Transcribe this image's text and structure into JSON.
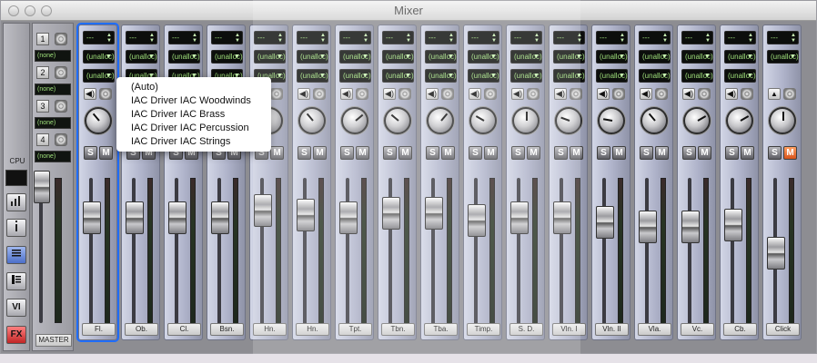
{
  "window": {
    "title": "Mixer"
  },
  "left_panel": {
    "cpu_label": "CPU",
    "buttons": [
      "",
      "",
      "",
      "",
      "VI",
      "FX"
    ]
  },
  "master": {
    "label": "MASTER",
    "rows": [
      {
        "num": "1",
        "route": "(none)"
      },
      {
        "num": "2",
        "route": "(none)"
      },
      {
        "num": "3",
        "route": "(none)"
      },
      {
        "num": "4",
        "route": "(none)"
      }
    ]
  },
  "strips": [
    {
      "name": "Fl.",
      "field1": "---",
      "field2": "(unalloc)",
      "field3": "(unalloc)",
      "solo": "S",
      "mute": "M",
      "fader_level": 0.8,
      "pan_deg": -40
    },
    {
      "name": "Ob.",
      "field1": "---",
      "field2": "(unalloc)",
      "field3": "(unalloc)",
      "solo": "S",
      "mute": "M",
      "fader_level": 0.8,
      "pan_deg": 0
    },
    {
      "name": "Cl.",
      "field1": "---",
      "field2": "(unalloc)",
      "field3": "(unalloc)",
      "solo": "S",
      "mute": "M",
      "fader_level": 0.8,
      "pan_deg": 0
    },
    {
      "name": "Bsn.",
      "field1": "---",
      "field2": "(unalloc)",
      "field3": "(unalloc)",
      "solo": "S",
      "mute": "M",
      "fader_level": 0.8,
      "pan_deg": 0
    },
    {
      "name": "Hn.",
      "field1": "---",
      "field2": "(unalloc)",
      "field3": "(unalloc)",
      "solo": "S",
      "mute": "M",
      "fader_level": 0.86,
      "pan_deg": 0
    },
    {
      "name": "Hn.",
      "field1": "---",
      "field2": "(unalloc)",
      "field3": "(unalloc)",
      "solo": "S",
      "mute": "M",
      "fader_level": 0.82,
      "pan_deg": -40
    },
    {
      "name": "Tpt.",
      "field1": "---",
      "field2": "(unalloc)",
      "field3": "(unalloc)",
      "solo": "S",
      "mute": "M",
      "fader_level": 0.8,
      "pan_deg": 50
    },
    {
      "name": "Tbn.",
      "field1": "---",
      "field2": "(unalloc)",
      "field3": "(unalloc)",
      "solo": "S",
      "mute": "M",
      "fader_level": 0.84,
      "pan_deg": -50
    },
    {
      "name": "Tba.",
      "field1": "---",
      "field2": "(unalloc)",
      "field3": "(unalloc)",
      "solo": "S",
      "mute": "M",
      "fader_level": 0.84,
      "pan_deg": 40
    },
    {
      "name": "Timp.",
      "field1": "---",
      "field2": "(unalloc)",
      "field3": "(unalloc)",
      "solo": "S",
      "mute": "M",
      "fader_level": 0.78,
      "pan_deg": -60
    },
    {
      "name": "S. D.",
      "field1": "---",
      "field2": "(unalloc)",
      "field3": "(unalloc)",
      "solo": "S",
      "mute": "M",
      "fader_level": 0.8,
      "pan_deg": 0
    },
    {
      "name": "Vln. I",
      "field1": "---",
      "field2": "(unalloc)",
      "field3": "(unalloc)",
      "solo": "S",
      "mute": "M",
      "fader_level": 0.8,
      "pan_deg": -70
    },
    {
      "name": "Vln. II",
      "field1": "---",
      "field2": "(unalloc)",
      "field3": "(unalloc)",
      "solo": "S",
      "mute": "M",
      "fader_level": 0.76,
      "pan_deg": -80
    },
    {
      "name": "Vla.",
      "field1": "---",
      "field2": "(unalloc)",
      "field3": "(unalloc)",
      "solo": "S",
      "mute": "M",
      "fader_level": 0.72,
      "pan_deg": -40
    },
    {
      "name": "Vc.",
      "field1": "---",
      "field2": "(unalloc)",
      "field3": "(unalloc)",
      "solo": "S",
      "mute": "M",
      "fader_level": 0.72,
      "pan_deg": 60
    },
    {
      "name": "Cb.",
      "field1": "---",
      "field2": "(unalloc)",
      "field3": "(unalloc)",
      "solo": "S",
      "mute": "M",
      "fader_level": 0.74,
      "pan_deg": 60
    },
    {
      "name": "Click",
      "field1": "---",
      "field2": "(unalloc)",
      "field3": "",
      "solo": "S",
      "mute": "M",
      "fader_level": 0.5,
      "pan_deg": 0,
      "mute_on": true
    }
  ],
  "popup_menu": {
    "items": [
      "(Auto)",
      "IAC Driver IAC Woodwinds",
      "IAC Driver IAC Brass",
      "IAC Driver IAC Percussion",
      "IAC Driver IAC Strings"
    ]
  },
  "colors": {
    "selected_outline": "#1f6dff",
    "lcd_text": "#9fe07b",
    "mute_active": "#e46a2a",
    "knob_led": "#7bdc3a"
  }
}
